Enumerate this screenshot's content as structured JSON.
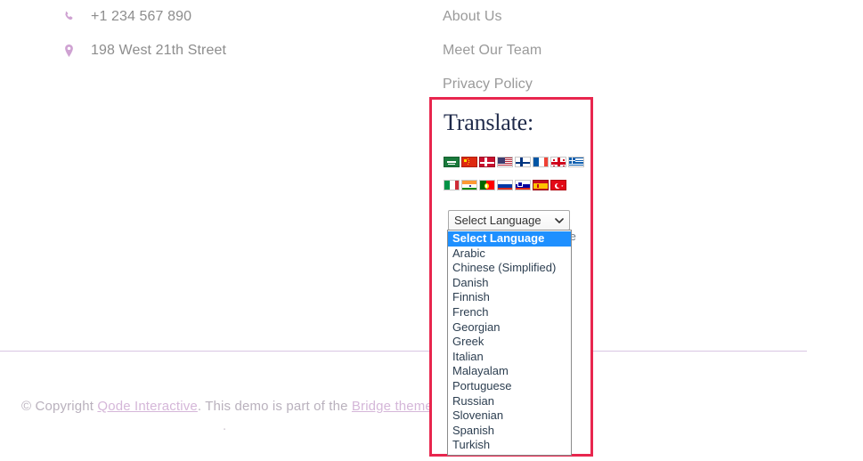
{
  "footer": {
    "contact": [
      {
        "icon": "phone-icon",
        "text": "+1 234 567 890"
      },
      {
        "icon": "map-pin-icon",
        "text": "198 West 21th Street"
      }
    ],
    "links": [
      {
        "label": "About Us"
      },
      {
        "label": "Meet Our Team"
      },
      {
        "label": "Privacy Policy"
      }
    ],
    "copyright": {
      "prefix": "© Copyright ",
      "link1": "Qode Interactive",
      "middle": ". This demo is part of the ",
      "link2": "Bridge theme",
      "period": "."
    }
  },
  "translate": {
    "title": "Translate:",
    "flags_row1": [
      {
        "name": "flag-saudi-arabia",
        "class": "f-sa",
        "title": "Arabic"
      },
      {
        "name": "flag-china",
        "class": "f-cn",
        "title": "Chinese (Simplified)"
      },
      {
        "name": "flag-denmark",
        "class": "f-dk",
        "title": "Danish"
      },
      {
        "name": "flag-united-states",
        "class": "f-us",
        "title": "English"
      },
      {
        "name": "flag-finland",
        "class": "f-fi",
        "title": "Finnish"
      },
      {
        "name": "flag-france",
        "class": "f-fr",
        "title": "French"
      },
      {
        "name": "flag-georgia",
        "class": "f-ge",
        "title": "Georgian"
      },
      {
        "name": "flag-greece",
        "class": "f-gr",
        "title": "Greek"
      }
    ],
    "flags_row2": [
      {
        "name": "flag-italy",
        "class": "f-it",
        "title": "Italian"
      },
      {
        "name": "flag-india",
        "class": "f-in",
        "title": "Malayalam"
      },
      {
        "name": "flag-portugal",
        "class": "f-pt",
        "title": "Portuguese"
      },
      {
        "name": "flag-russia",
        "class": "f-ru",
        "title": "Russian"
      },
      {
        "name": "flag-slovenia",
        "class": "f-si",
        "title": "Slovenian"
      },
      {
        "name": "flag-spain",
        "class": "f-es",
        "title": "Spanish"
      },
      {
        "name": "flag-turkey",
        "class": "f-tr",
        "title": "Turkish"
      }
    ],
    "select": {
      "value": "Select Language",
      "options": [
        "Select Language",
        "Arabic",
        "Chinese (Simplified)",
        "Danish",
        "Finnish",
        "French",
        "Georgian",
        "Greek",
        "Italian",
        "Malayalam",
        "Portuguese",
        "Russian",
        "Slovenian",
        "Spanish",
        "Turkish"
      ],
      "selected_index": 0
    },
    "ghost_text": "te"
  },
  "colors": {
    "highlight_border": "#e8264e",
    "option_selected_bg": "#1e90ff",
    "accent_link": "#d5b7d9",
    "icon_accent": "#cfa2d2",
    "divider": "#d9c6e3"
  }
}
